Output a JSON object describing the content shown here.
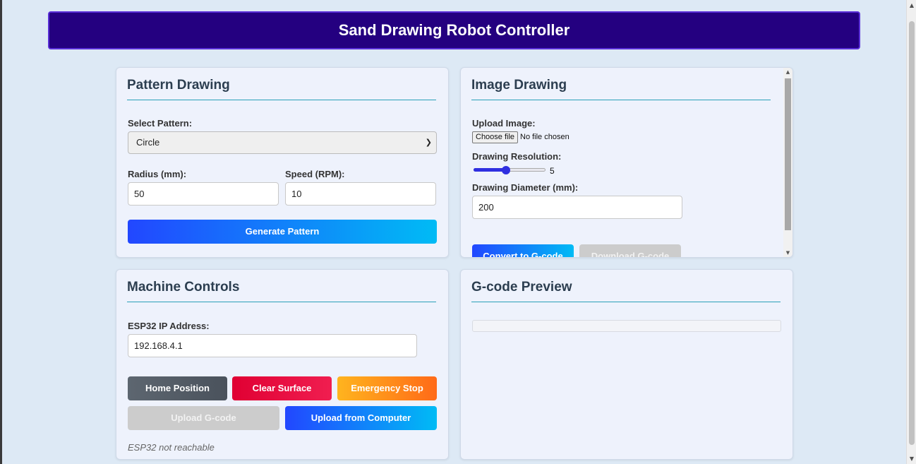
{
  "header": {
    "title": "Sand Drawing Robot Controller"
  },
  "pattern": {
    "title": "Pattern Drawing",
    "select_label": "Select Pattern:",
    "selected": "Circle",
    "radius_label": "Radius (mm):",
    "radius_value": "50",
    "speed_label": "Speed (RPM):",
    "speed_value": "10",
    "generate_label": "Generate Pattern"
  },
  "image": {
    "title": "Image Drawing",
    "upload_label": "Upload Image:",
    "choose_file": "Choose file",
    "no_file": "No file chosen",
    "resolution_label": "Drawing Resolution:",
    "resolution_value": "5",
    "resolution_fraction": 0.45,
    "diameter_label": "Drawing Diameter (mm):",
    "diameter_value": "200",
    "convert_label": "Convert to G-code",
    "download_label": "Download G-code"
  },
  "machine": {
    "title": "Machine Controls",
    "ip_label": "ESP32 IP Address:",
    "ip_value": "192.168.4.1",
    "home_label": "Home Position",
    "clear_label": "Clear Surface",
    "emergency_label": "Emergency Stop",
    "upload_gcode_label": "Upload G-code",
    "upload_computer_label": "Upload from Computer",
    "status": "ESP32 not reachable"
  },
  "preview": {
    "title": "G-code Preview"
  },
  "colors": {
    "header_bg": "#240080",
    "accent_blue": "#2247ff",
    "danger": "#e00033",
    "warning": "#ff8c1a",
    "rule": "#2aa0b8"
  }
}
